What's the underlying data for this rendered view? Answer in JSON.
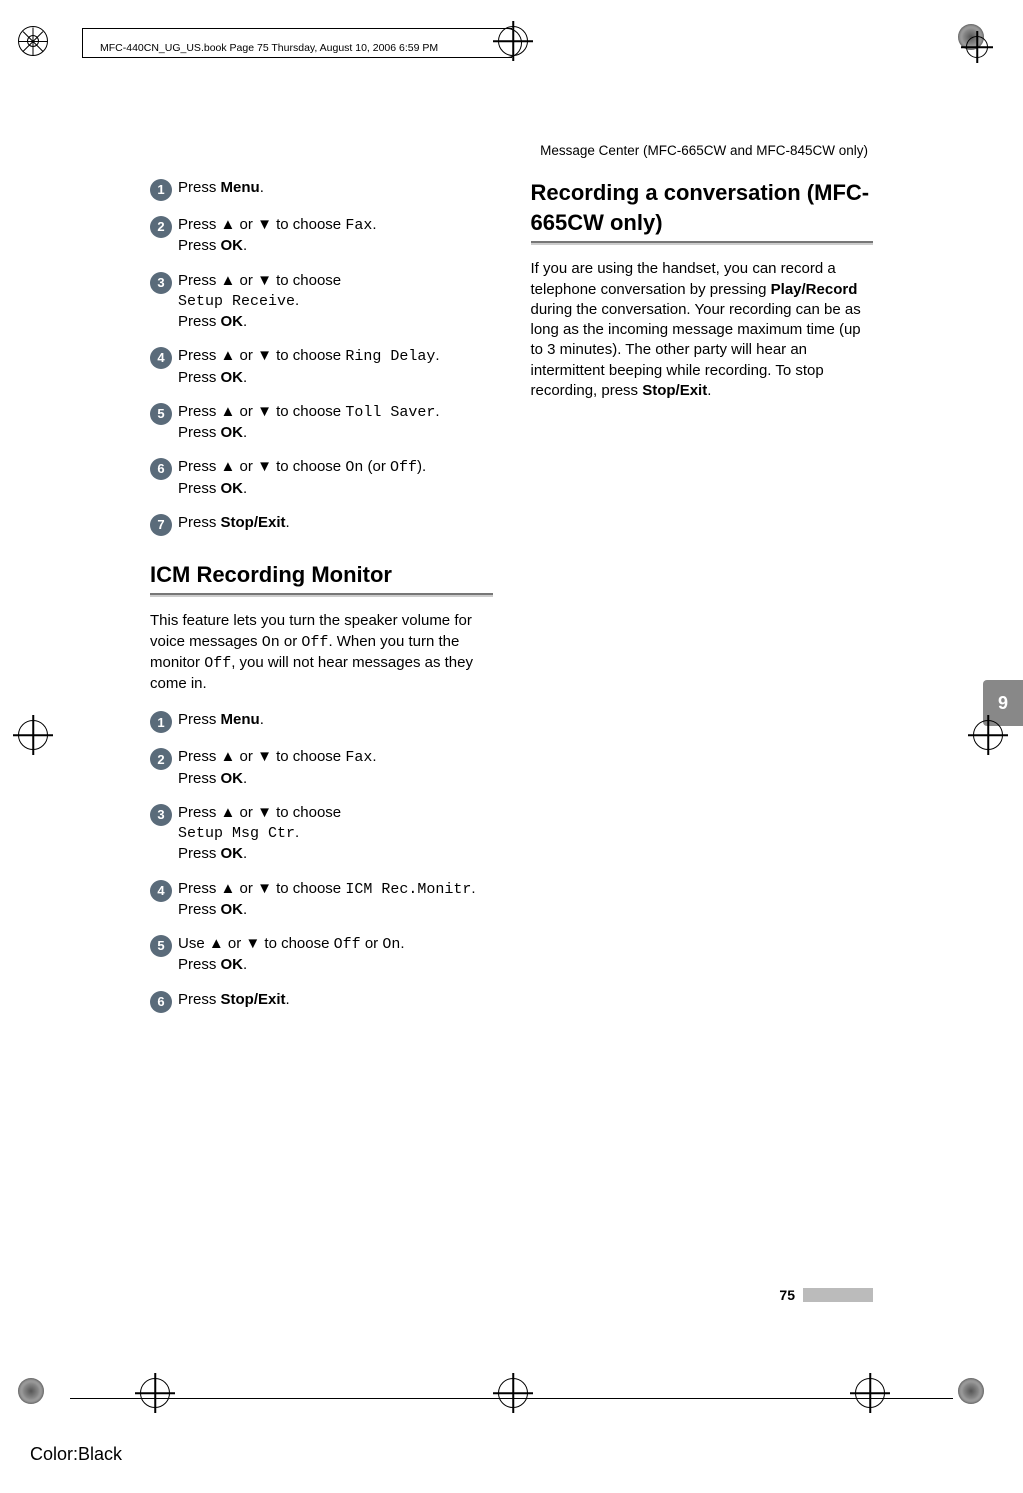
{
  "meta": {
    "header_tag": "MFC-440CN_UG_US.book  Page 75  Thursday, August 10, 2006  6:59 PM",
    "running_header": "Message Center (MFC-665CW and MFC-845CW only)",
    "side_tab": "9",
    "page_number": "75",
    "color_label": "Color:Black"
  },
  "left": {
    "stepsA": [
      {
        "n": "1",
        "parts": [
          {
            "t": "Press "
          },
          {
            "t": "Menu",
            "b": true
          },
          {
            "t": "."
          }
        ]
      },
      {
        "n": "2",
        "parts": [
          {
            "t": "Press "
          },
          {
            "t": "a",
            "arrow": "up"
          },
          {
            "t": " or "
          },
          {
            "t": "b",
            "arrow": "down"
          },
          {
            "t": " to choose "
          },
          {
            "t": "Fax",
            "mono": true
          },
          {
            "t": ".\nPress "
          },
          {
            "t": "OK",
            "b": true
          },
          {
            "t": "."
          }
        ]
      },
      {
        "n": "3",
        "parts": [
          {
            "t": "Press "
          },
          {
            "t": "a",
            "arrow": "up"
          },
          {
            "t": " or "
          },
          {
            "t": "b",
            "arrow": "down"
          },
          {
            "t": " to choose\n"
          },
          {
            "t": "Setup Receive",
            "mono": true
          },
          {
            "t": ".\nPress "
          },
          {
            "t": "OK",
            "b": true
          },
          {
            "t": "."
          }
        ]
      },
      {
        "n": "4",
        "parts": [
          {
            "t": "Press "
          },
          {
            "t": "a",
            "arrow": "up"
          },
          {
            "t": " or "
          },
          {
            "t": "b",
            "arrow": "down"
          },
          {
            "t": " to choose "
          },
          {
            "t": "Ring Delay",
            "mono": true
          },
          {
            "t": ".\nPress "
          },
          {
            "t": "OK",
            "b": true
          },
          {
            "t": "."
          }
        ]
      },
      {
        "n": "5",
        "parts": [
          {
            "t": "Press "
          },
          {
            "t": "a",
            "arrow": "up"
          },
          {
            "t": " or "
          },
          {
            "t": "b",
            "arrow": "down"
          },
          {
            "t": " to choose "
          },
          {
            "t": "Toll Saver",
            "mono": true
          },
          {
            "t": ".\nPress "
          },
          {
            "t": "OK",
            "b": true
          },
          {
            "t": "."
          }
        ]
      },
      {
        "n": "6",
        "parts": [
          {
            "t": "Press "
          },
          {
            "t": "a",
            "arrow": "up"
          },
          {
            "t": " or "
          },
          {
            "t": "b",
            "arrow": "down"
          },
          {
            "t": " to choose "
          },
          {
            "t": "On",
            "mono": true
          },
          {
            "t": " (or "
          },
          {
            "t": "Off",
            "mono": true
          },
          {
            "t": ").\nPress "
          },
          {
            "t": "OK",
            "b": true
          },
          {
            "t": "."
          }
        ]
      },
      {
        "n": "7",
        "parts": [
          {
            "t": "Press "
          },
          {
            "t": "Stop/Exit",
            "b": true
          },
          {
            "t": "."
          }
        ]
      }
    ],
    "heading1": "ICM Recording Monitor",
    "intro1_parts": [
      {
        "t": "This feature lets you turn the speaker volume for voice messages "
      },
      {
        "t": "On",
        "mono": true
      },
      {
        "t": " or "
      },
      {
        "t": "Off",
        "mono": true
      },
      {
        "t": ". When you turn the monitor "
      },
      {
        "t": "Off",
        "mono": true
      },
      {
        "t": ", you will not hear messages as they come in."
      }
    ],
    "stepsB": [
      {
        "n": "1",
        "parts": [
          {
            "t": "Press "
          },
          {
            "t": "Menu",
            "b": true
          },
          {
            "t": "."
          }
        ]
      },
      {
        "n": "2",
        "parts": [
          {
            "t": "Press "
          },
          {
            "t": "a",
            "arrow": "up"
          },
          {
            "t": " or "
          },
          {
            "t": "b",
            "arrow": "down"
          },
          {
            "t": " to choose "
          },
          {
            "t": "Fax",
            "mono": true
          },
          {
            "t": ".\nPress "
          },
          {
            "t": "OK",
            "b": true
          },
          {
            "t": "."
          }
        ]
      },
      {
        "n": "3",
        "parts": [
          {
            "t": "Press "
          },
          {
            "t": "a",
            "arrow": "up"
          },
          {
            "t": " or "
          },
          {
            "t": "b",
            "arrow": "down"
          },
          {
            "t": " to choose\n"
          },
          {
            "t": "Setup Msg Ctr",
            "mono": true
          },
          {
            "t": ".\nPress "
          },
          {
            "t": "OK",
            "b": true
          },
          {
            "t": "."
          }
        ]
      },
      {
        "n": "4",
        "parts": [
          {
            "t": "Press "
          },
          {
            "t": "a",
            "arrow": "up"
          },
          {
            "t": " or "
          },
          {
            "t": "b",
            "arrow": "down"
          },
          {
            "t": " to choose "
          },
          {
            "t": "ICM Rec.Monitr",
            "mono": true
          },
          {
            "t": ".\nPress "
          },
          {
            "t": "OK",
            "b": true
          },
          {
            "t": "."
          }
        ]
      },
      {
        "n": "5",
        "parts": [
          {
            "t": "Use "
          },
          {
            "t": "a",
            "arrow": "up"
          },
          {
            "t": " or "
          },
          {
            "t": "b",
            "arrow": "down"
          },
          {
            "t": " to choose "
          },
          {
            "t": "Off",
            "mono": true
          },
          {
            "t": " or "
          },
          {
            "t": "On",
            "mono": true
          },
          {
            "t": ".\nPress "
          },
          {
            "t": "OK",
            "b": true
          },
          {
            "t": "."
          }
        ]
      },
      {
        "n": "6",
        "parts": [
          {
            "t": "Press "
          },
          {
            "t": "Stop/Exit",
            "b": true
          },
          {
            "t": "."
          }
        ]
      }
    ]
  },
  "right": {
    "heading": "Recording a conversation (MFC-665CW only)",
    "body_parts": [
      {
        "t": "If you are using the handset, you can record a telephone conversation by pressing "
      },
      {
        "t": "Play/Record",
        "b": true
      },
      {
        "t": " during the conversation. Your recording can be as long as the incoming message maximum time (up to 3 minutes). The other party will hear an intermittent beeping while recording. To stop recording, press "
      },
      {
        "t": "Stop/Exit",
        "b": true
      },
      {
        "t": "."
      }
    ]
  }
}
